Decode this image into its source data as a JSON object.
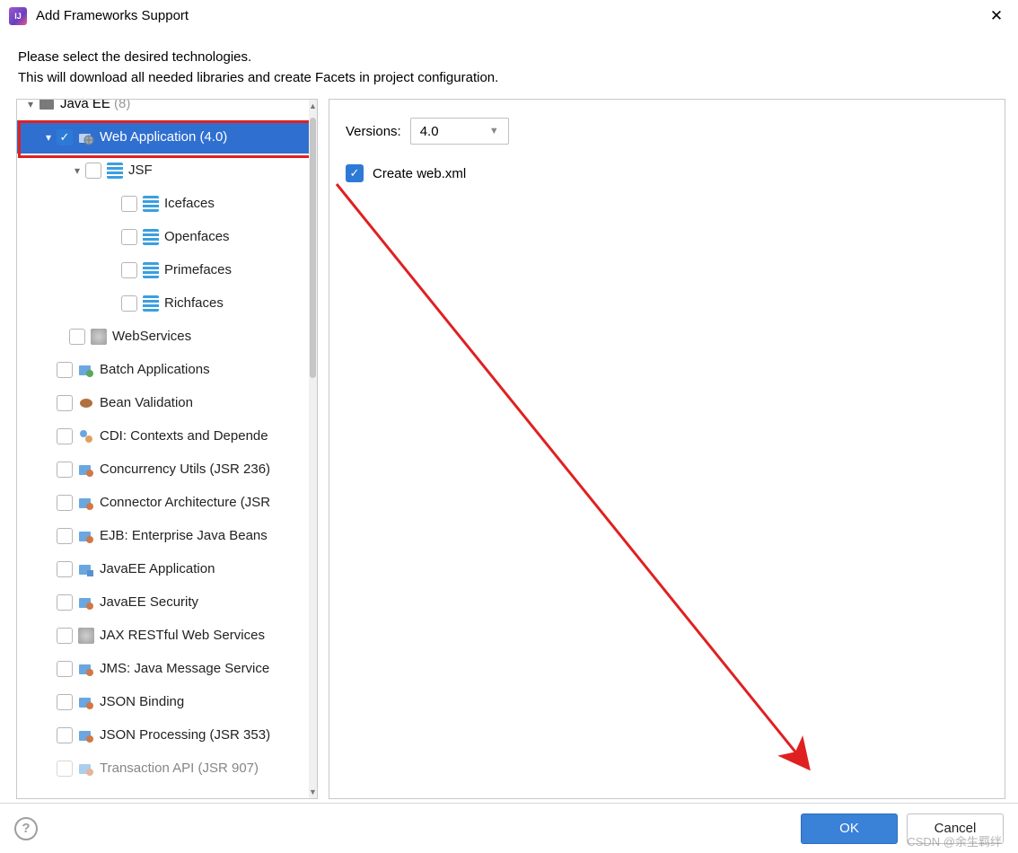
{
  "window": {
    "title": "Add Frameworks Support"
  },
  "subtitle_line1": "Please select the desired technologies.",
  "subtitle_line2": "This will download all needed libraries and create Facets in project configuration.",
  "tree": {
    "root": {
      "name": "Java EE",
      "count": "(8)"
    },
    "selected": {
      "label": "Web Application (4.0)"
    },
    "jsf": "JSF",
    "faces": [
      "Icefaces",
      "Openfaces",
      "Primefaces",
      "Richfaces"
    ],
    "webservices": "WebServices",
    "items": [
      "Batch Applications",
      "Bean Validation",
      "CDI: Contexts and Depende",
      "Concurrency Utils (JSR 236)",
      "Connector Architecture (JSR",
      "EJB: Enterprise Java Beans",
      "JavaEE Application",
      "JavaEE Security",
      "JAX RESTful Web Services",
      "JMS: Java Message Service",
      "JSON Binding",
      "JSON Processing (JSR 353)",
      "Transaction API (JSR 907)"
    ]
  },
  "right": {
    "versions_label": "Versions:",
    "version_value": "4.0",
    "create_webxml": "Create web.xml"
  },
  "buttons": {
    "ok": "OK",
    "cancel": "Cancel",
    "help": "?"
  },
  "watermark": "CSDN @余生羁绊"
}
